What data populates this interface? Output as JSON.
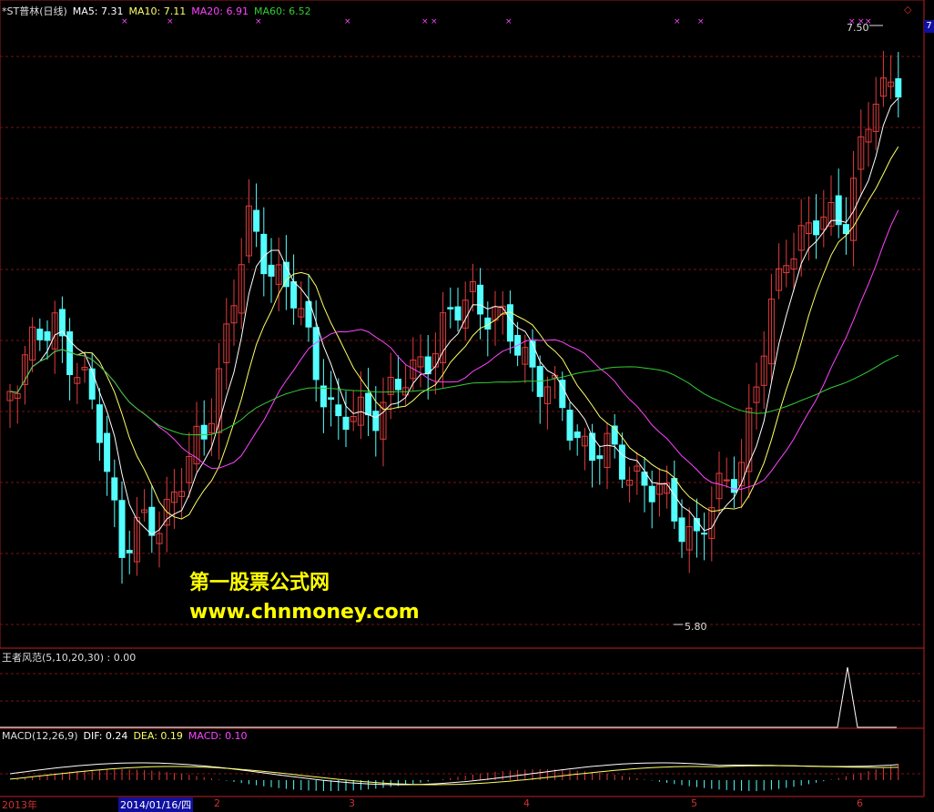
{
  "legend_main": {
    "stock": "*ST普林(日线)",
    "ma5": "MA5: 7.31",
    "ma10": "MA10: 7.11",
    "ma20": "MA20: 6.91",
    "ma60": "MA60: 6.52"
  },
  "legend_wz": "王者风范(5,10,20,30) : 0.00",
  "legend_macd": {
    "name": "MACD(12,26,9)",
    "dif": "DIF: 0.24",
    "dea": "DEA: 0.19",
    "macd": "MACD: 0.10"
  },
  "price_high": "7.50",
  "price_low": "5.80",
  "watermark": {
    "line1": "第一股票公式网",
    "line2": "www.chnmoney.com"
  },
  "x_axis": {
    "year": "2013年",
    "cursor_date": "2014/01/16/四",
    "months": [
      "2",
      "3",
      "4",
      "5",
      "6"
    ]
  },
  "corner_box": "7",
  "colors": {
    "up": "#e03c3c",
    "down": "#54ffff",
    "ma5": "#ffffff",
    "ma10": "#ffff66",
    "ma20": "#ff44ff",
    "ma60": "#33cc33",
    "grid": "#7a1212"
  }
}
